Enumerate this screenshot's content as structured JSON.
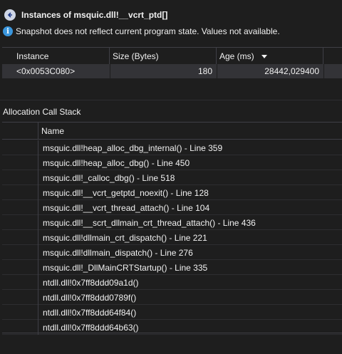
{
  "header": {
    "title": "Instances of msquic.dll!__vcrt_ptd[]",
    "info": "Snapshot does not reflect current program state. Values not available."
  },
  "instances": {
    "columns": {
      "instance": "Instance",
      "size": "Size (Bytes)",
      "age": "Age (ms)"
    },
    "rows": [
      {
        "instance": "<0x0053C080>",
        "size": "180",
        "age": "28442,029400"
      }
    ]
  },
  "call_stack": {
    "label": "Allocation Call Stack",
    "column": "Name",
    "frames": [
      "msquic.dll!heap_alloc_dbg_internal() - Line 359",
      "msquic.dll!heap_alloc_dbg() - Line 450",
      "msquic.dll!_calloc_dbg() - Line 518",
      "msquic.dll!__vcrt_getptd_noexit() - Line 128",
      "msquic.dll!__vcrt_thread_attach() - Line 104",
      "msquic.dll!__scrt_dllmain_crt_thread_attach() - Line 436",
      "msquic.dll!dllmain_crt_dispatch() - Line 221",
      "msquic.dll!dllmain_dispatch() - Line 276",
      "msquic.dll!_DllMainCRTStartup() - Line 335",
      "ntdll.dll!0x7ff8ddd09a1d()",
      "ntdll.dll!0x7ff8ddd0789f()",
      "ntdll.dll!0x7ff8ddd64f84()",
      "ntdll.dll!0x7ff8ddd64b63()"
    ]
  }
}
